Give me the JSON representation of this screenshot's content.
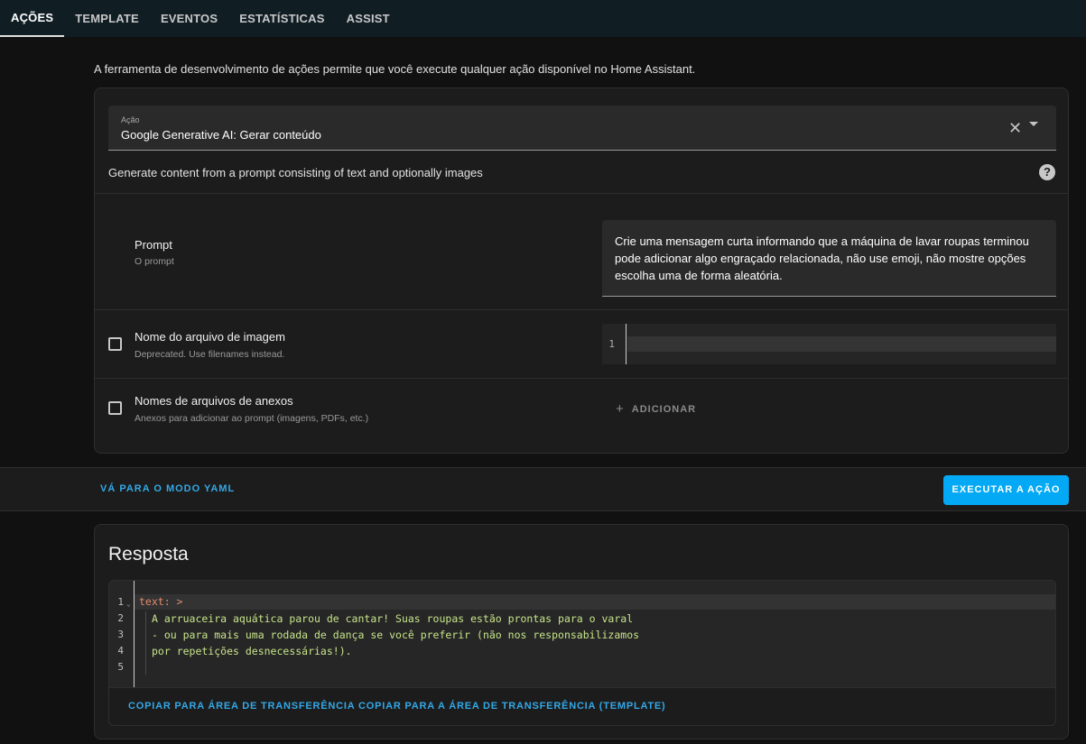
{
  "tabs": [
    {
      "label": "AÇÕES",
      "active": true
    },
    {
      "label": "TEMPLATE",
      "active": false
    },
    {
      "label": "EVENTOS",
      "active": false
    },
    {
      "label": "ESTATÍSTICAS",
      "active": false
    },
    {
      "label": "ASSIST",
      "active": false
    }
  ],
  "intro": "A ferramenta de desenvolvimento de ações permite que você execute qualquer ação disponível no Home Assistant.",
  "action": {
    "label": "Ação",
    "value": "Google Generative AI: Gerar conteúdo",
    "description": "Generate content from a prompt consisting of text and optionally images",
    "icons": {
      "clear": "close-icon",
      "dropdown": "arrow-drop-down-icon",
      "help": "help-circle-icon"
    }
  },
  "fields": {
    "prompt": {
      "title": "Prompt",
      "subtitle": "O prompt",
      "lines": [
        "Crie uma mensagem curta  informando que a máquina de lavar roupas terminou",
        "pode adicionar algo engraçado relacionada, não use emoji, não mostre opções",
        "escolha uma de forma aleatória."
      ]
    },
    "image_filename": {
      "title": "Nome do arquivo de imagem",
      "subtitle": "Deprecated. Use filenames instead.",
      "line_number": "1"
    },
    "attachments": {
      "title": "Nomes de arquivos de anexos",
      "subtitle": "Anexos para adicionar ao prompt (imagens, PDFs, etc.)",
      "add_label": "ADICIONAR",
      "add_icon": "plus-icon"
    }
  },
  "toolbar": {
    "yaml_link": "VÁ PARA O MODO YAML",
    "run_button": "EXECUTAR A AÇÃO"
  },
  "response": {
    "title": "Resposta",
    "line_numbers": [
      "1",
      "2",
      "3",
      "4",
      "5"
    ],
    "key": "text",
    "separator": ": >",
    "lines": [
      "A arruaceira aquática parou de cantar! Suas roupas estão prontas para o varal",
      "- ou para mais uma rodada de dança se você preferir (não nos responsabilizamos",
      "por repetições desnecessárias!)."
    ],
    "copy_label": "COPIAR PARA ÁREA DE TRANSFERÊNCIA",
    "copy_template_label": "COPIAR PARA A ÁREA DE TRANSFERÊNCIA (TEMPLATE)"
  }
}
